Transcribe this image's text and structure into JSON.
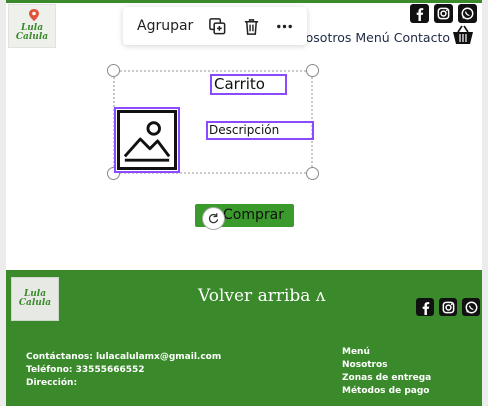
{
  "header": {
    "logo_text": "Lula Calula",
    "nav": [
      "Nosotros",
      "Menú",
      "Contacto"
    ],
    "social": [
      "facebook-icon",
      "instagram-icon",
      "whatsapp-icon"
    ]
  },
  "toolbar": {
    "group_label": "Agrupar",
    "icons": [
      "duplicate-icon",
      "trash-icon",
      "more-icon"
    ]
  },
  "card": {
    "title": "Carrito",
    "description": "Descripción",
    "button_label": "Comprar",
    "image_icon": "image-placeholder-icon"
  },
  "footer": {
    "logo_text": "Lula Calula",
    "back_to_top": "Volver arriba ʌ",
    "contact": [
      "Contáctanos: lulacalulamx@gmail.com",
      "Teléfono: 33555666552",
      "Dirección:"
    ],
    "links": [
      "Menú",
      "Nosotros",
      "Zonas de entrega",
      "Métodos de pago"
    ]
  },
  "colors": {
    "brand_green": "#3a8a2c",
    "selection_purple": "#8a4bff"
  }
}
